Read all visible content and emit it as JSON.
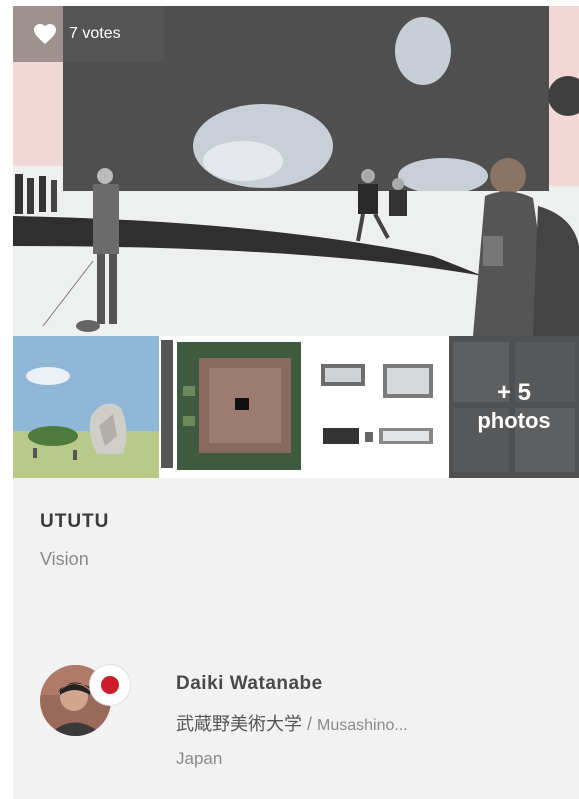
{
  "votes": {
    "count_label": "7 votes",
    "icon": "heart-icon"
  },
  "gallery": {
    "more_count": "+ 5",
    "more_label": "photos"
  },
  "project": {
    "title": "UTUTU",
    "category": "Vision"
  },
  "author": {
    "name": "Daiki Watanabe",
    "affiliation_jp": "武蔵野美術大学",
    "affiliation_sep": " / ",
    "affiliation_en": "Musashino...",
    "country": "Japan",
    "flag_color": "#cc1d2b"
  }
}
